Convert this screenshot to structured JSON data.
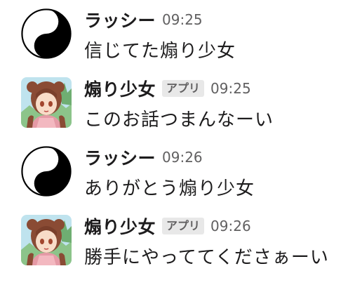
{
  "messages": [
    {
      "author": "ラッシー",
      "avatar": "yin-yang-icon",
      "time": "09:25",
      "text": "信じてた煽り少女"
    },
    {
      "author": "煽り少女",
      "avatar": "anime-girl-avatar",
      "badge": "アプリ",
      "time": "09:25",
      "text": "このお話つまんなーい"
    },
    {
      "author": "ラッシー",
      "avatar": "yin-yang-icon",
      "time": "09:26",
      "text": "ありがとう煽り少女"
    },
    {
      "author": "煽り少女",
      "avatar": "anime-girl-avatar",
      "badge": "アプリ",
      "time": "09:26",
      "text": "勝手にやっててくださぁーい"
    }
  ]
}
